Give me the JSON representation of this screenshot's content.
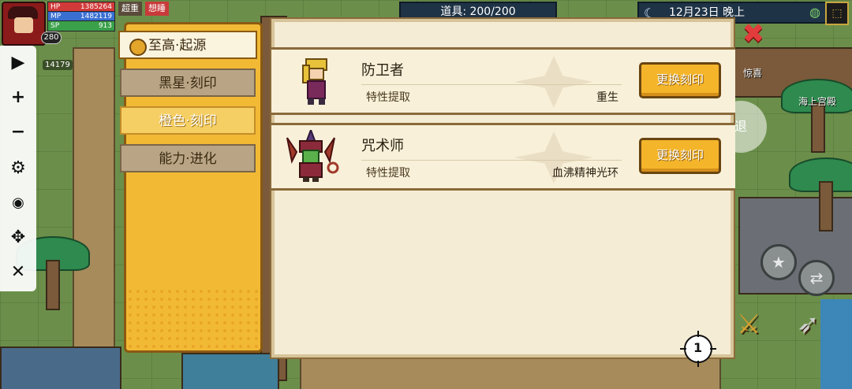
{
  "hud": {
    "hp_label": "HP",
    "hp_value": "1385264",
    "mp_label": "MP",
    "mp_value": "1482119",
    "sp_label": "SP",
    "sp_value": "913",
    "level": "280",
    "gold": "14179",
    "top_tabs": [
      "超重",
      "想睡"
    ]
  },
  "topbar": {
    "items_label": "道具: 200/200",
    "date": "12月23日 晚上"
  },
  "tabs": [
    {
      "label": "至高·起源",
      "state": "active"
    },
    {
      "label": "黑星·刻印",
      "state": "inactive"
    },
    {
      "label": "橙色·刻印",
      "state": "highlight"
    },
    {
      "label": "能力·进化",
      "state": "inactive"
    }
  ],
  "cards": [
    {
      "name": "防卫者",
      "sub_label": "特性提取",
      "sub_value": "重生",
      "action": "更换刻印"
    },
    {
      "name": "咒术师",
      "sub_label": "特性提取",
      "sub_value": "血沸精神光环",
      "action": "更换刻印"
    }
  ],
  "page": {
    "current": "1"
  },
  "side": {
    "label_1": "惊喜",
    "label_2": "海上宫殿",
    "bubble": "退"
  },
  "colors": {
    "panel_gold": "#f2b935",
    "button_gold": "#f4b52a",
    "panel_cream": "#f5ecd5",
    "close_red": "#e23c3c"
  }
}
